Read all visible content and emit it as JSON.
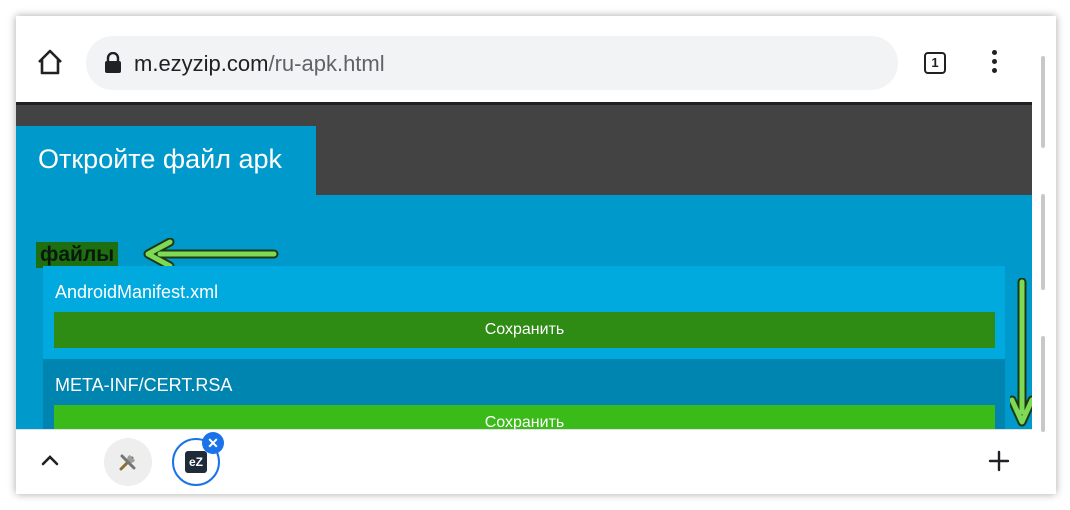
{
  "browser": {
    "url_domain": "m.ezyzip.com",
    "url_path": "/ru-apk.html",
    "tab_count": "1",
    "icons": [
      "home-icon",
      "lock-icon",
      "tab-switcher-icon",
      "more-vert-icon"
    ]
  },
  "page": {
    "tab_title": "Откройте файл apk",
    "files_label": "файлы",
    "files": [
      {
        "name": "AndroidManifest.xml",
        "save_label": "Сохранить"
      },
      {
        "name": "META-INF/CERT.RSA",
        "save_label": "Сохранить"
      }
    ],
    "colors": {
      "page_bg": "#0099cc",
      "header_bg": "#434343",
      "item_bg_1": "#00aadf",
      "item_bg_2": "#0084b0",
      "save_1": "#2e8b13",
      "save_2": "#3bbb1a",
      "annotation_arrow": "#7ed957"
    }
  },
  "bottom_bar": {
    "ez_logo_text": "eZ",
    "close_glyph": "✕",
    "icons": [
      "chevron-up-icon",
      "tools-icon",
      "close-icon",
      "plus-icon"
    ]
  }
}
